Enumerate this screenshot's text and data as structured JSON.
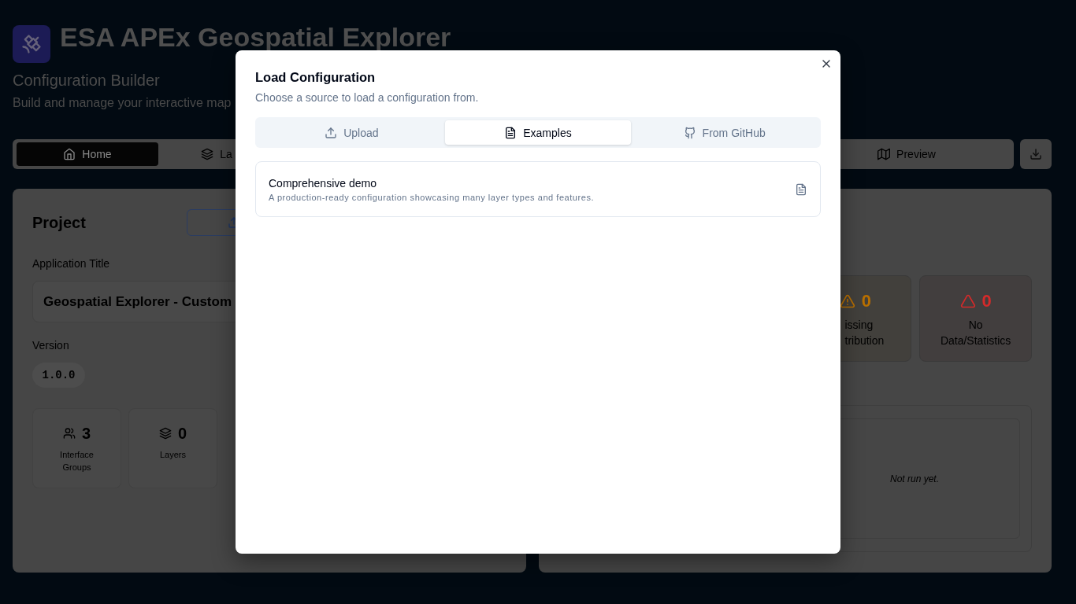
{
  "header": {
    "title": "ESA APEx Geospatial Explorer",
    "subtitle": "Configuration Builder",
    "description": "Build and manage your interactive map"
  },
  "nav": {
    "tabs": [
      {
        "kind": "home",
        "label": "Home",
        "selected": true
      },
      {
        "kind": "layers",
        "label": "La",
        "selected": false
      },
      {
        "kind": "map",
        "label": "Preview",
        "selected": false
      }
    ]
  },
  "project": {
    "title": "Project",
    "title_field": {
      "label": "Application Title",
      "value": "Geospatial Explorer - Custom"
    },
    "version_field": {
      "label": "Version",
      "value": "1.0.0"
    },
    "stats": [
      {
        "kind": "groups",
        "value": "3",
        "label_lines": [
          "Interface",
          "Groups"
        ]
      },
      {
        "kind": "layers",
        "value": "0",
        "label_lines": [
          "Layers"
        ]
      }
    ]
  },
  "checks": {
    "stats": [
      {
        "kind": "warning",
        "value": "0",
        "color": "#b86f00",
        "label_lines": [
          "issing",
          "tribution"
        ]
      },
      {
        "kind": "alert",
        "value": "0",
        "color": "#d42a2a",
        "label_lines": [
          "No",
          "Data/Statistics"
        ]
      }
    ],
    "result": {
      "message": "Not run yet."
    }
  },
  "dialog": {
    "title": "Load Configuration",
    "description": "Choose a source to load a configuration from.",
    "tabs": [
      {
        "kind": "upload",
        "label": "Upload",
        "selected": false
      },
      {
        "kind": "file",
        "label": "Examples",
        "selected": true
      },
      {
        "kind": "github",
        "label": "From GitHub",
        "selected": false
      }
    ],
    "examples": [
      {
        "title": "Comprehensive demo",
        "description": "A production-ready configuration showcasing many layer types and features."
      }
    ]
  }
}
